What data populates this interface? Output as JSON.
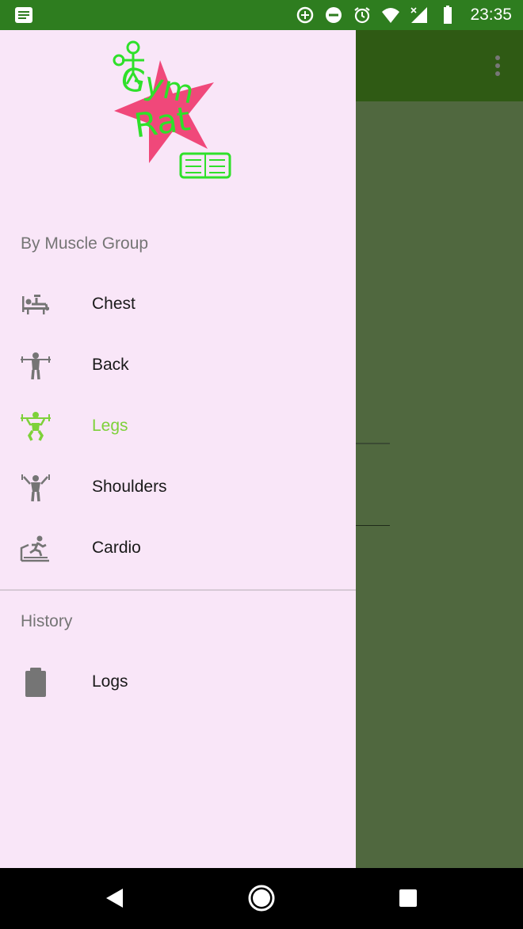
{
  "status_bar": {
    "time": "23:35",
    "icons": [
      "notification-icon",
      "data-saver-icon",
      "do-not-disturb-icon",
      "alarm-icon",
      "wifi-icon",
      "signal-icon",
      "battery-icon"
    ]
  },
  "toolbar": {
    "overflow_icon": "more-vert-icon"
  },
  "drawer": {
    "logo_text": "Gym Rat",
    "sections": [
      {
        "label": "By Muscle Group",
        "items": [
          {
            "label": "Chest",
            "icon": "bench-press-icon",
            "active": false
          },
          {
            "label": "Back",
            "icon": "back-exercise-icon",
            "active": false
          },
          {
            "label": "Legs",
            "icon": "squat-icon",
            "active": true
          },
          {
            "label": "Shoulders",
            "icon": "shoulder-press-icon",
            "active": false
          },
          {
            "label": "Cardio",
            "icon": "treadmill-icon",
            "active": false
          }
        ]
      },
      {
        "label": "History",
        "items": [
          {
            "label": "Logs",
            "icon": "clipboard-icon",
            "active": false
          }
        ]
      }
    ]
  },
  "colors": {
    "status_bar": "#2e7d1f",
    "toolbar": "#2f5a14",
    "drawer_bg": "#f9e6f8",
    "active": "#7ed13a",
    "icon": "#757575"
  },
  "nav_bar": {
    "icons": [
      "back-icon",
      "home-icon",
      "recents-icon"
    ]
  }
}
